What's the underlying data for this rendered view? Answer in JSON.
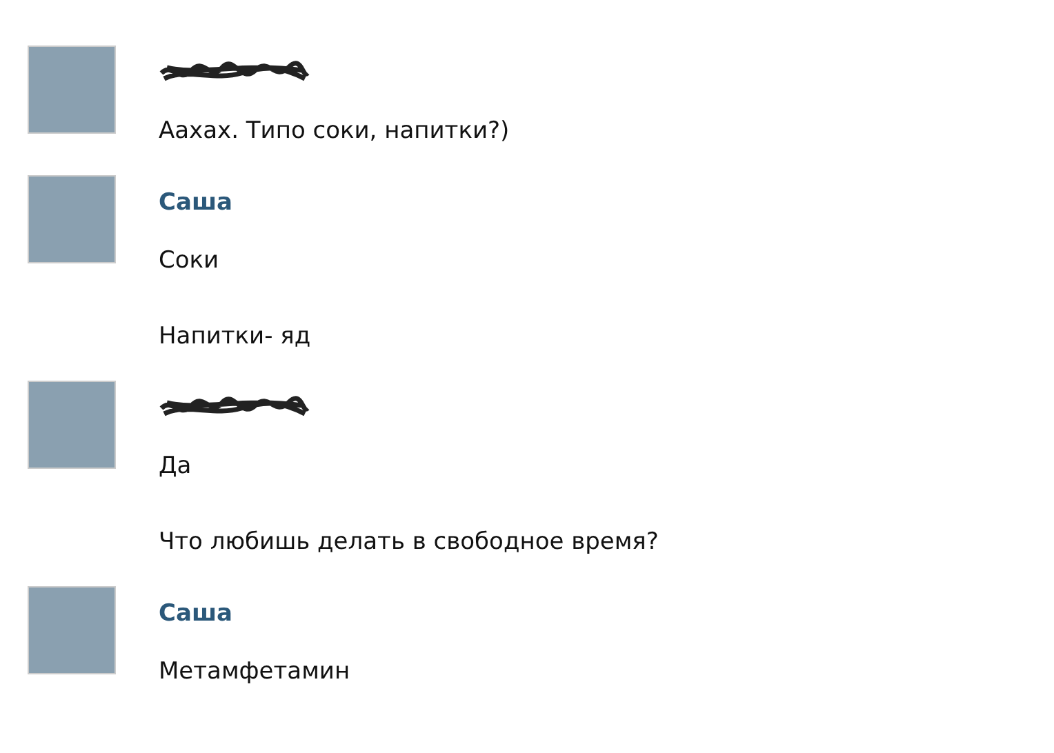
{
  "messages": [
    {
      "sender": {
        "kind": "redacted"
      },
      "lines": [
        "Аахах. Типо соки, напитки?)"
      ]
    },
    {
      "sender": {
        "kind": "name",
        "name": "Саша"
      },
      "lines": [
        "Соки",
        "Напитки- яд"
      ]
    },
    {
      "sender": {
        "kind": "redacted"
      },
      "lines": [
        "Да",
        "Что любишь делать в свободное время?"
      ]
    },
    {
      "sender": {
        "kind": "name",
        "name": "Саша"
      },
      "lines": [
        "Метамфетамин"
      ]
    }
  ]
}
